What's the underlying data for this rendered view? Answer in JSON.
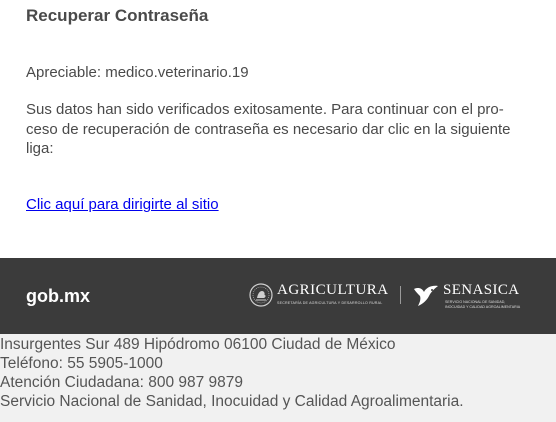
{
  "email": {
    "title": "Recuperar Contraseña",
    "greeting": "Apreciable: medico.veterinario.19",
    "body_lines": [
      "Sus datos han sido verificados exitosamente. Para continuar con el pro-",
      "ceso de recuperación de contraseña es necesario dar clic en la siguiente",
      "liga:"
    ],
    "link_text": "Clic aquí para dirigirte al sitio"
  },
  "banner": {
    "gob_logo": "gob.mx",
    "agricultura": {
      "name": "AGRICULTURA",
      "subtitle": "SECRETARÍA DE AGRICULTURA Y DESARROLLO RURAL"
    },
    "senasica": {
      "name": "SENASICA",
      "subtitle_lines": [
        "SERVICIO NACIONAL DE SANIDAD,",
        "INOCUIDAD Y CALIDAD AGROALIMENTARIA"
      ]
    }
  },
  "footer": {
    "address": "Insurgentes Sur 489 Hipódromo 06100 Ciudad de México",
    "phone": "Teléfono: 55 5905-1000",
    "citizen_service": "Atención Ciudadana: 800 987 9879",
    "agency": "Servicio Nacional de Sanidad, Inocuidad y Calidad Agroalimentaria."
  },
  "colors": {
    "banner_bg": "#3b3b3b",
    "footer_bg": "#f1f1f1",
    "link": "#0000ee",
    "text": "#4a4a4a"
  },
  "icons": {
    "agricultura_seal": "mexican-coat-of-arms-icon",
    "senasica_mark": "senasica-eagle-icon"
  }
}
